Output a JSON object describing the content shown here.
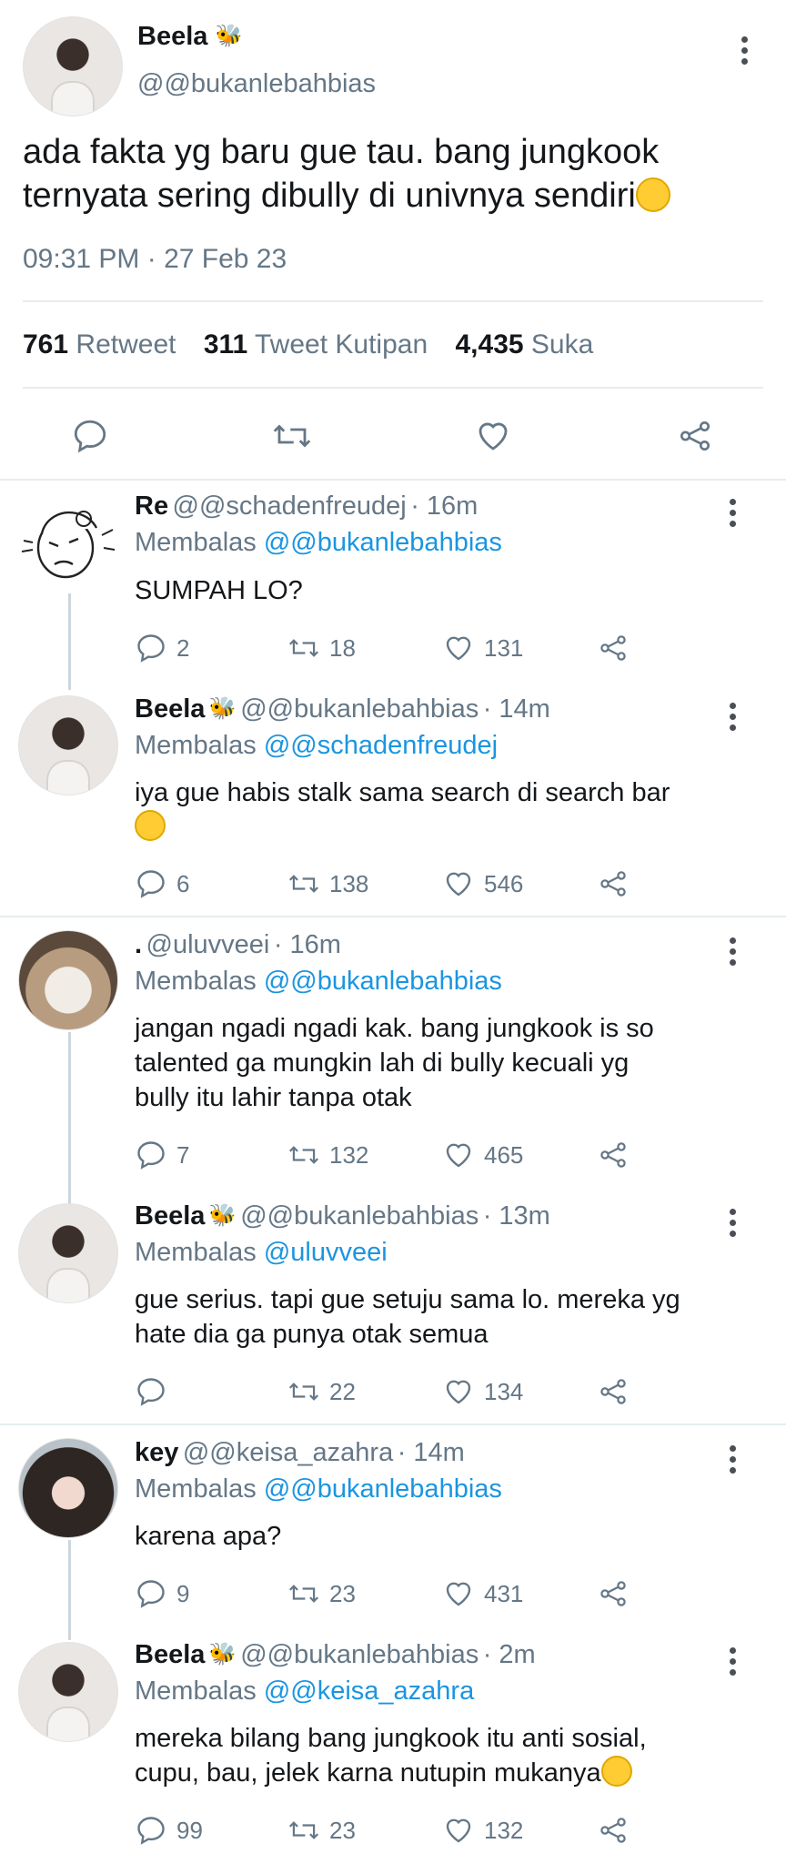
{
  "main_tweet": {
    "name": "Beela",
    "badge": "🐝",
    "handle": "@@bukanlebahbias",
    "text_line1": "ada fakta yg baru gue tau. bang jungkook",
    "text_line2": "ternyata sering dibully di univnya sendiri",
    "timestamp": "09:31 PM · 27 Feb 23",
    "retweet_count": "761",
    "retweet_label": "Retweet",
    "quote_count": "311",
    "quote_label": "Tweet Kutipan",
    "like_count": "4,435",
    "like_label": "Suka"
  },
  "replies": [
    {
      "name": "Re",
      "handle": "@@schadenfreudej",
      "time": "· 16m",
      "reply_prefix": "Membalas",
      "reply_to": "@@bukanlebahbias",
      "text": "SUMPAH LO?",
      "replies": "2",
      "retweets": "18",
      "likes": "131"
    },
    {
      "name": "Beela",
      "badge": "🐝",
      "handle": "@@bukanlebahbias",
      "time": "· 14m",
      "reply_prefix": "Membalas",
      "reply_to": "@@schadenfreudej",
      "text": "iya gue habis stalk sama search di search bar",
      "replies": "6",
      "retweets": "138",
      "likes": "546"
    },
    {
      "name": ".",
      "handle": "@uluvveei",
      "time": "· 16m",
      "reply_prefix": "Membalas",
      "reply_to": "@@bukanlebahbias",
      "text_line1": "jangan ngadi ngadi kak. bang jungkook is so",
      "text_line2": "talented ga mungkin lah di bully kecuali yg",
      "text_line3": "bully itu lahir tanpa otak",
      "replies": "7",
      "retweets": "132",
      "likes": "465"
    },
    {
      "name": "Beela",
      "badge": "🐝",
      "handle": "@@bukanlebahbias",
      "time": "· 13m",
      "reply_prefix": "Membalas",
      "reply_to": "@uluvveei",
      "text_line1": "gue serius. tapi gue setuju sama lo. mereka yg",
      "text_line2": "hate dia ga punya otak semua",
      "retweets": "22",
      "likes": "134"
    },
    {
      "name": "key",
      "handle": "@@keisa_azahra",
      "time": "· 14m",
      "reply_prefix": "Membalas",
      "reply_to": "@@bukanlebahbias",
      "text": "karena apa?",
      "replies": "9",
      "retweets": "23",
      "likes": "431"
    },
    {
      "name": "Beela",
      "badge": "🐝",
      "handle": "@@bukanlebahbias",
      "time": "· 2m",
      "reply_prefix": "Membalas",
      "reply_to": "@@keisa_azahra",
      "text_line1": "mereka bilang bang jungkook itu anti sosial,",
      "text_line2": "cupu, bau, jelek karna nutupin mukanya",
      "replies": "99",
      "retweets": "23",
      "likes": "132"
    }
  ]
}
